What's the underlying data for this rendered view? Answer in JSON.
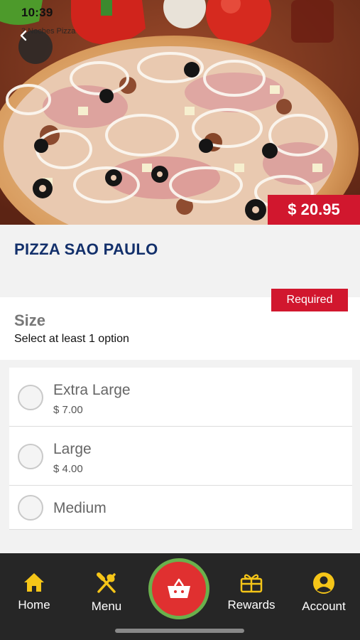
{
  "status_bar": {
    "time": "10:39",
    "carrier": "3 Noches Pizza"
  },
  "hero": {
    "image": "pizza-photo"
  },
  "nav": {
    "back_icon": "chevron-left-icon"
  },
  "product": {
    "price": "$ 20.95",
    "name": "PIZZA SAO PAULO"
  },
  "section": {
    "required_label": "Required",
    "title": "Size",
    "subtitle": "Select at least 1 option"
  },
  "options": [
    {
      "name": "Extra Large",
      "price": "$ 7.00"
    },
    {
      "name": "Large",
      "price": "$ 4.00"
    },
    {
      "name": "Medium"
    }
  ],
  "tabs": [
    {
      "label": "Home",
      "icon": "home-icon"
    },
    {
      "label": "Menu",
      "icon": "fork-knife-icon"
    },
    {
      "label": "Rewards",
      "icon": "gift-icon"
    },
    {
      "label": "Account",
      "icon": "account-icon"
    }
  ],
  "cart": {
    "icon": "basket-icon"
  },
  "colors": {
    "accent_red": "#d1172e",
    "tab_yellow": "#f5c518",
    "tab_bar": "#262626",
    "title_blue": "#13306b",
    "cart_ring": "#6ab04c"
  }
}
